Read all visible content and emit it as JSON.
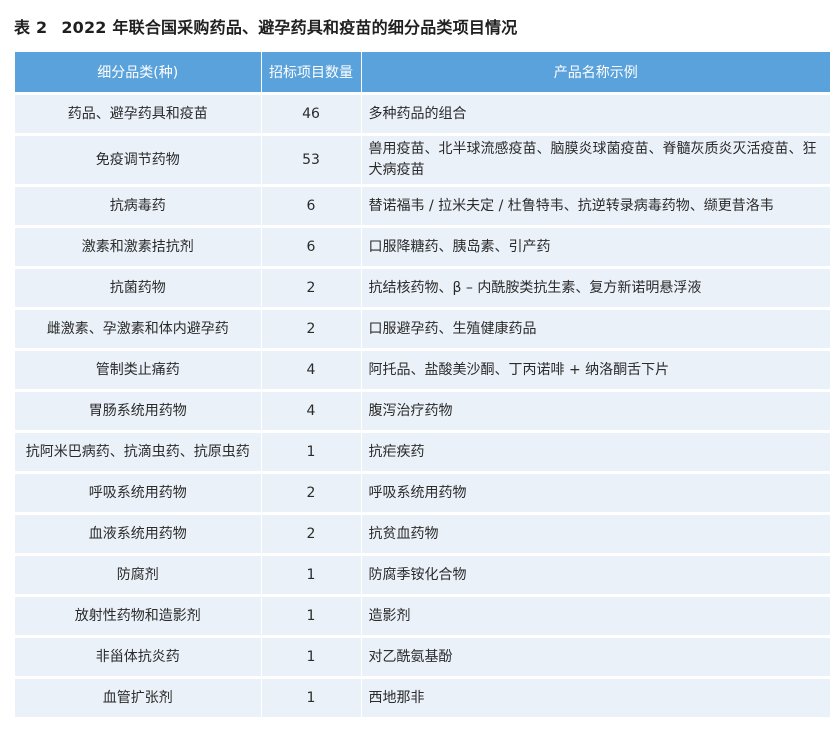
{
  "caption": {
    "number": "表 2",
    "title": "2022 年联合国采购药品、避孕药具和疫苗的细分品类项目情况"
  },
  "table": {
    "headers": [
      "细分品类(种)",
      "招标项目数量",
      "产品名称示例"
    ],
    "rows": [
      {
        "category": "药品、避孕药具和疫苗",
        "count": "46",
        "examples": "多种药品的组合"
      },
      {
        "category": "免疫调节药物",
        "count": "53",
        "examples": "兽用疫苗、北半球流感疫苗、脑膜炎球菌疫苗、脊髓灰质炎灭活疫苗、狂犬病疫苗"
      },
      {
        "category": "抗病毒药",
        "count": "6",
        "examples": "替诺福韦 / 拉米夫定 / 杜鲁特韦、抗逆转录病毒药物、缬更昔洛韦"
      },
      {
        "category": "激素和激素拮抗剂",
        "count": "6",
        "examples": "口服降糖药、胰岛素、引产药"
      },
      {
        "category": "抗菌药物",
        "count": "2",
        "examples": "抗结核药物、β – 内酰胺类抗生素、复方新诺明悬浮液"
      },
      {
        "category": "雌激素、孕激素和体内避孕药",
        "count": "2",
        "examples": "口服避孕药、生殖健康药品"
      },
      {
        "category": "管制类止痛药",
        "count": "4",
        "examples": "阿托品、盐酸美沙酮、丁丙诺啡 + 纳洛酮舌下片"
      },
      {
        "category": "胃肠系统用药物",
        "count": "4",
        "examples": "腹泻治疗药物"
      },
      {
        "category": "抗阿米巴病药、抗滴虫药、抗原虫药",
        "count": "1",
        "examples": "抗疟疾药"
      },
      {
        "category": "呼吸系统用药物",
        "count": "2",
        "examples": "呼吸系统用药物"
      },
      {
        "category": "血液系统用药物",
        "count": "2",
        "examples": "抗贫血药物"
      },
      {
        "category": "防腐剂",
        "count": "1",
        "examples": "防腐季铵化合物"
      },
      {
        "category": "放射性药物和造影剂",
        "count": "1",
        "examples": "造影剂"
      },
      {
        "category": "非甾体抗炎药",
        "count": "1",
        "examples": "对乙酰氨基酚"
      },
      {
        "category": "血管扩张剂",
        "count": "1",
        "examples": "西地那非"
      }
    ]
  }
}
